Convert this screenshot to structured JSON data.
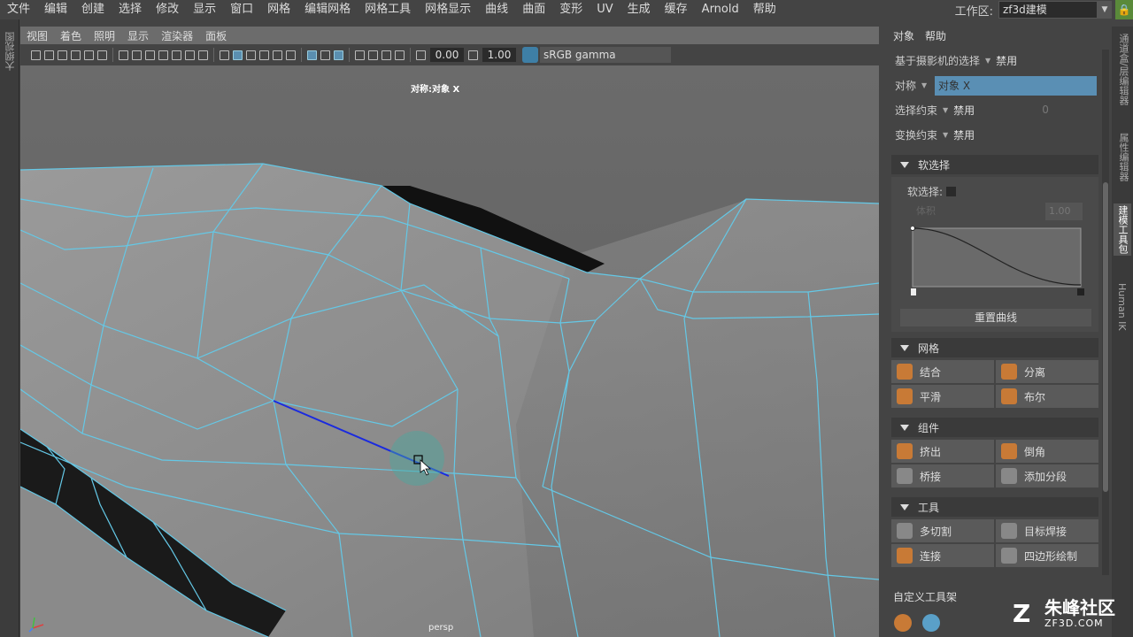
{
  "menubar": {
    "items": [
      "文件",
      "编辑",
      "创建",
      "选择",
      "修改",
      "显示",
      "窗口",
      "网格",
      "编辑网格",
      "网格工具",
      "网格显示",
      "曲线",
      "曲面",
      "变形",
      "UV",
      "生成",
      "缓存",
      "Arnold",
      "帮助"
    ]
  },
  "workspace": {
    "label": "工作区:",
    "value": "zf3d建模"
  },
  "leftbar": {
    "label": "大纲视图"
  },
  "viewport": {
    "menu": [
      "视图",
      "着色",
      "照明",
      "显示",
      "渲染器",
      "面板"
    ],
    "num1": "0.00",
    "num2": "1.00",
    "gamma": "sRGB gamma",
    "sym_label": "对称:对象 X",
    "camera": "persp"
  },
  "panel": {
    "menu": [
      "对象",
      "帮助"
    ],
    "camera_select": {
      "label": "基于摄影机的选择",
      "value": "禁用"
    },
    "symmetry": {
      "label": "对称",
      "value": "对象 X"
    },
    "select_constraint": {
      "label": "选择约束",
      "value": "禁用",
      "extra": "0"
    },
    "transform_constraint": {
      "label": "变换约束",
      "value": "禁用"
    },
    "soft_select": {
      "title": "软选择",
      "check_label": "软选择:",
      "volume": "体积",
      "value": "1.00",
      "reset": "重置曲线"
    },
    "mesh": {
      "title": "网格",
      "buttons": [
        "结合",
        "分离",
        "平滑",
        "布尔"
      ]
    },
    "component": {
      "title": "组件",
      "buttons": [
        "挤出",
        "倒角",
        "桥接",
        "添加分段"
      ]
    },
    "tools": {
      "title": "工具",
      "buttons": [
        "多切割",
        "目标焊接",
        "连接",
        "四边形绘制"
      ]
    },
    "shelf": {
      "title": "自定义工具架"
    }
  },
  "vtabs": [
    "通道盒/层编辑器",
    "属性编辑器",
    "建模工具包",
    "Human IK"
  ],
  "watermark": {
    "brand": "朱峰社区",
    "url": "ZF3D.COM"
  },
  "colors": {
    "wire": "#64c8e6",
    "selected_edge": "#1a2adf",
    "accent": "#5a8fb4",
    "icon_orange": "#c87a36"
  }
}
